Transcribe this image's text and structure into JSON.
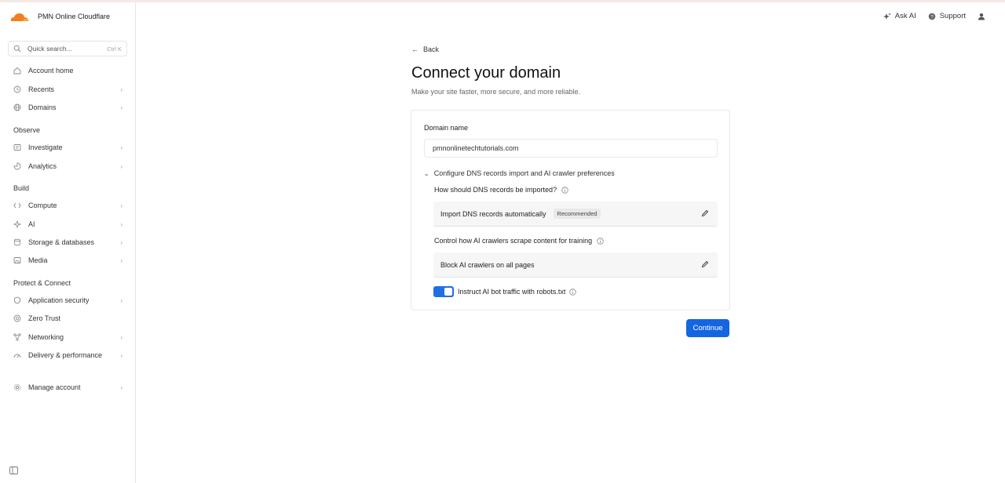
{
  "sidebar": {
    "account_name": "PMN Online Cloudflare",
    "search": {
      "placeholder": "Quick search...",
      "shortcut": "Ctrl K"
    },
    "items": [
      {
        "label": "Account home",
        "icon": "home-icon",
        "chevron": false
      },
      {
        "label": "Recents",
        "icon": "clock-icon",
        "chevron": true
      },
      {
        "label": "Domains",
        "icon": "globe-icon",
        "chevron": true
      }
    ],
    "sections": [
      {
        "title": "Observe",
        "items": [
          {
            "label": "Investigate",
            "icon": "investigate-icon",
            "chevron": true
          },
          {
            "label": "Analytics",
            "icon": "analytics-icon",
            "chevron": true
          }
        ]
      },
      {
        "title": "Build",
        "items": [
          {
            "label": "Compute",
            "icon": "compute-icon",
            "chevron": true
          },
          {
            "label": "AI",
            "icon": "ai-icon",
            "chevron": true
          },
          {
            "label": "Storage & databases",
            "icon": "database-icon",
            "chevron": true
          },
          {
            "label": "Media",
            "icon": "media-icon",
            "chevron": true
          }
        ]
      },
      {
        "title": "Protect & Connect",
        "items": [
          {
            "label": "Application security",
            "icon": "shield-icon",
            "chevron": true
          },
          {
            "label": "Zero Trust",
            "icon": "zero-trust-icon",
            "chevron": false
          },
          {
            "label": "Networking",
            "icon": "network-icon",
            "chevron": true
          },
          {
            "label": "Delivery & performance",
            "icon": "delivery-icon",
            "chevron": true
          }
        ]
      }
    ],
    "manage": {
      "label": "Manage account",
      "icon": "gear-icon",
      "chevron": true
    }
  },
  "topbar": {
    "ask_ai": "Ask AI",
    "support": "Support"
  },
  "main": {
    "back": "Back",
    "title": "Connect your domain",
    "subtitle": "Make your site faster, more secure, and more reliable.",
    "domain_label": "Domain name",
    "domain_value": "pmnonlinetechtutorials.com",
    "config_toggle": "Configure DNS records import and AI crawler preferences",
    "dns_question": "How should DNS records be imported?",
    "dns_option": "Import DNS records automatically",
    "dns_badge": "Recommended",
    "ai_question": "Control how AI crawlers scrape content for training",
    "ai_option": "Block AI crawlers on all pages",
    "robots_label": "Instruct AI bot traffic with robots.txt",
    "robots_enabled": true,
    "continue": "Continue"
  },
  "colors": {
    "accent": "#1466e0",
    "toggle": "#1f6fe5",
    "logo_orange": "#f38020",
    "logo_light": "#fbad41"
  }
}
